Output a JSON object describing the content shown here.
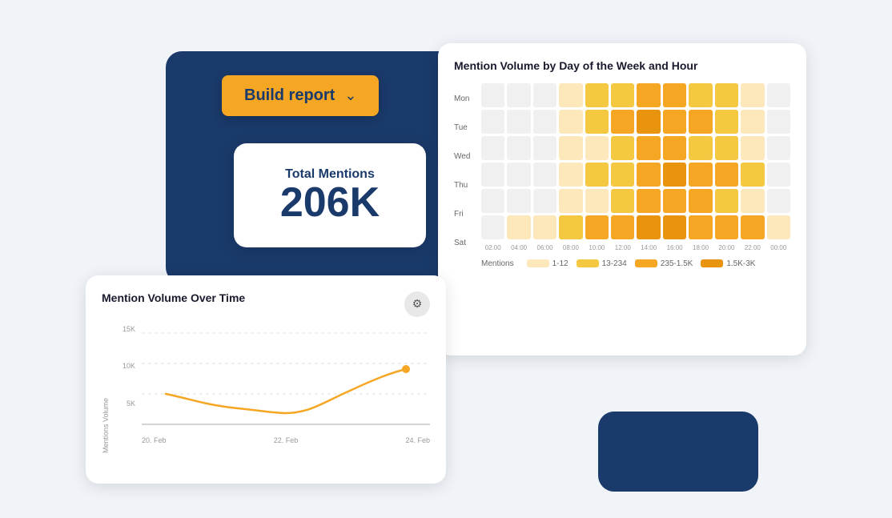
{
  "buildReport": {
    "label": "Build report",
    "chevron": "⌄"
  },
  "totalMentions": {
    "label": "Total Mentions",
    "value": "206K"
  },
  "heatmap": {
    "title": "Mention Volume by Day of the Week and Hour",
    "days": [
      "Mon",
      "Tue",
      "Wed",
      "Thu",
      "Fri",
      "Sat"
    ],
    "hours": [
      "02:00",
      "04:00",
      "06:00",
      "08:00",
      "10:00",
      "12:00",
      "14:00",
      "16:00",
      "18:00",
      "20:00",
      "22:00",
      "00:00"
    ],
    "rows": [
      [
        0,
        0,
        0,
        1,
        2,
        2,
        3,
        3,
        2,
        2,
        1,
        0
      ],
      [
        0,
        0,
        0,
        1,
        2,
        3,
        4,
        3,
        3,
        2,
        1,
        0
      ],
      [
        0,
        0,
        0,
        1,
        1,
        2,
        3,
        3,
        2,
        2,
        1,
        0
      ],
      [
        0,
        0,
        0,
        1,
        2,
        2,
        3,
        4,
        3,
        3,
        2,
        0
      ],
      [
        0,
        0,
        0,
        1,
        1,
        2,
        3,
        3,
        3,
        2,
        1,
        0
      ],
      [
        0,
        1,
        1,
        2,
        3,
        3,
        4,
        4,
        3,
        3,
        3,
        1
      ]
    ],
    "legend": {
      "label": "Mentions",
      "items": [
        "1-12",
        "13-234",
        "235-1.5K",
        "1.5K-3K"
      ]
    }
  },
  "lineChart": {
    "title": "Mention Volume Over Time",
    "yLabels": [
      "15K",
      "10K",
      "5K",
      ""
    ],
    "xLabels": [
      "20. Feb",
      "22. Feb",
      "24. Feb"
    ],
    "yAxisTitle": "Mentions Volume",
    "gearIcon": "⚙"
  }
}
